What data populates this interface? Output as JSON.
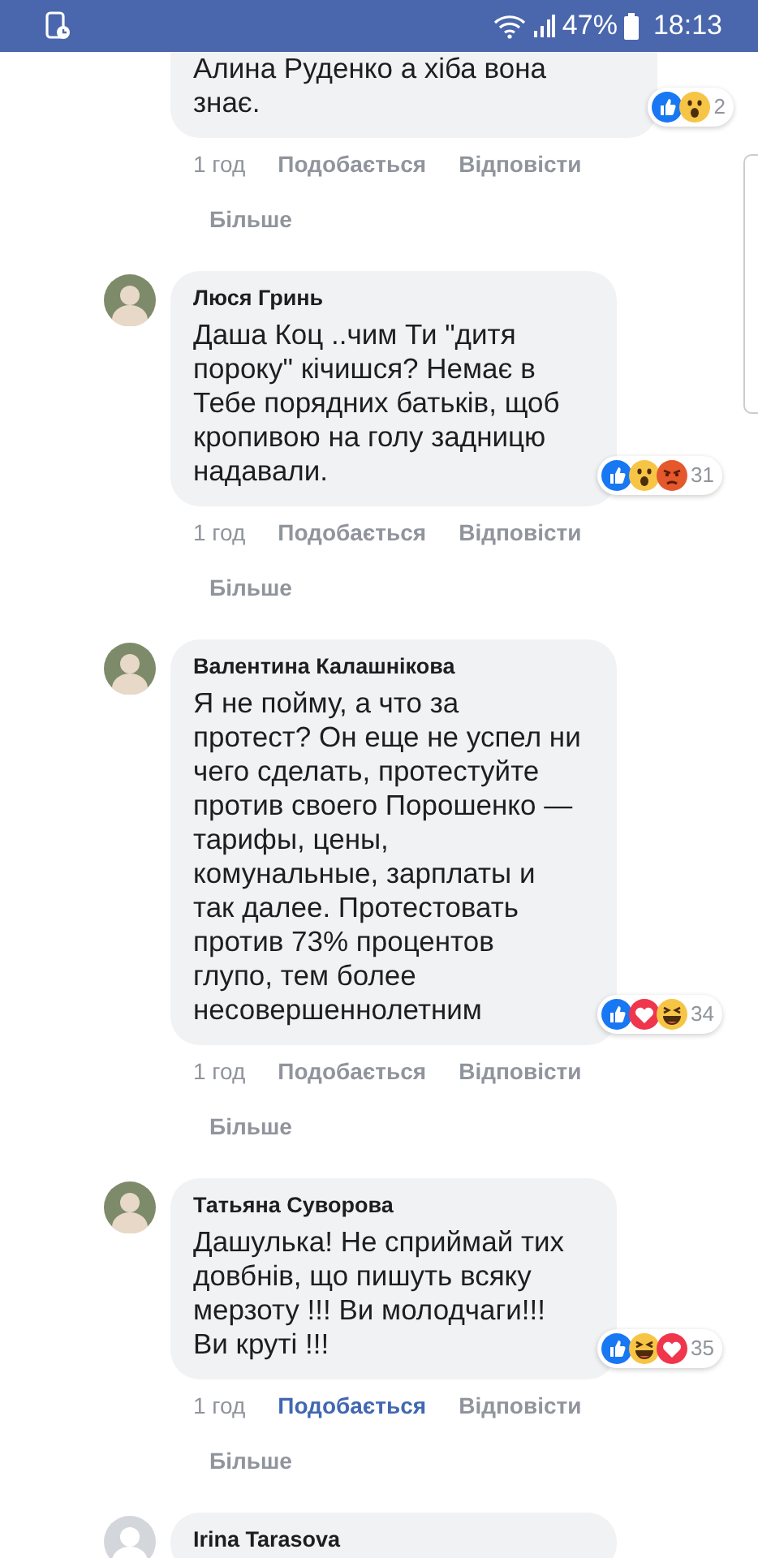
{
  "status_bar": {
    "battery": "47%",
    "time": "18:13"
  },
  "comments": [
    {
      "lines": [
        "Алина Руденко а хіба вона",
        "знає."
      ],
      "reactions": [
        {
          "kind": "like"
        },
        {
          "kind": "wow"
        }
      ],
      "reaction_count": "2",
      "time": "1 год",
      "like_label": "Подобається",
      "liked": false,
      "reply_label": "Відповісти",
      "more_label": "Більше"
    },
    {
      "author": "Люся Гринь",
      "avatar_photo": true,
      "lines": [
        "Даша Коц ..чим Ти \"дитя",
        "пороку\" кічишся? Немає в",
        "Тебе порядних батьків, щоб",
        "кропивою на голу задницю",
        "надавали."
      ],
      "reactions": [
        {
          "kind": "like"
        },
        {
          "kind": "wow"
        },
        {
          "kind": "angry"
        }
      ],
      "reaction_count": "31",
      "time": "1 год",
      "like_label": "Подобається",
      "liked": false,
      "reply_label": "Відповісти",
      "more_label": "Більше"
    },
    {
      "author": "Валентина Калашнікова",
      "avatar_photo": true,
      "lines": [
        "Я не пойму, а что за",
        "протест? Он еще не успел ни",
        "чего сделать, протестуйте",
        "против своего Порошенко —",
        "тарифы, цены,",
        "комунальные, зарплаты и",
        "так далее. Протестовать",
        "против 73% процентов",
        "глупо, тем более",
        "несовершеннолетним"
      ],
      "reactions": [
        {
          "kind": "like"
        },
        {
          "kind": "love"
        },
        {
          "kind": "haha"
        }
      ],
      "reaction_count": "34",
      "time": "1 год",
      "like_label": "Подобається",
      "liked": false,
      "reply_label": "Відповісти",
      "more_label": "Більше"
    },
    {
      "author": "Татьяна Суворова",
      "avatar_photo": true,
      "lines": [
        "Дашулька! Не сприймай тих",
        "довбнів, що пишуть всяку",
        "мерзоту !!! Ви молодчаги!!!",
        "Ви круті !!!"
      ],
      "reactions": [
        {
          "kind": "like"
        },
        {
          "kind": "haha"
        },
        {
          "kind": "love"
        }
      ],
      "reaction_count": "35",
      "time": "1 год",
      "like_label": "Подобається",
      "liked": true,
      "reply_label": "Відповісти",
      "more_label": "Більше"
    },
    {
      "author": "Irina Tarasova",
      "avatar_photo": false
    }
  ]
}
